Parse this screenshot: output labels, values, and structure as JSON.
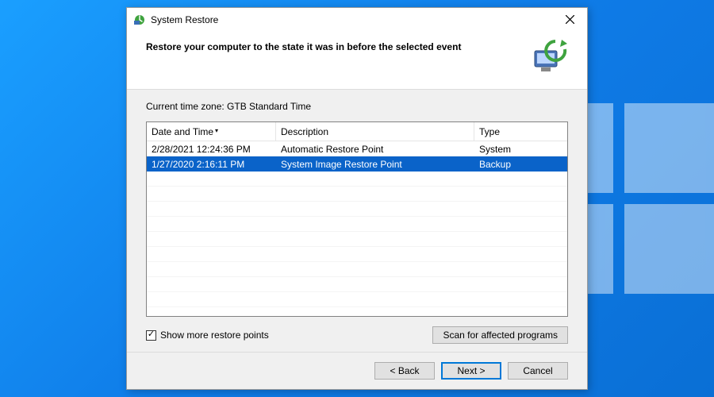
{
  "window": {
    "title": "System Restore",
    "heading": "Restore your computer to the state it was in before the selected event"
  },
  "timezone_label": "Current time zone: GTB Standard Time",
  "columns": {
    "date": "Date and Time",
    "desc": "Description",
    "type": "Type"
  },
  "rows": [
    {
      "date": "2/28/2021 12:24:36 PM",
      "desc": "Automatic Restore Point",
      "type": "System",
      "selected": false
    },
    {
      "date": "1/27/2020 2:16:11 PM",
      "desc": "System Image Restore Point",
      "type": "Backup",
      "selected": true
    }
  ],
  "checkbox": {
    "label": "Show more restore points",
    "checked": true
  },
  "buttons": {
    "scan": "Scan for affected programs",
    "back": "< Back",
    "next": "Next >",
    "cancel": "Cancel"
  }
}
